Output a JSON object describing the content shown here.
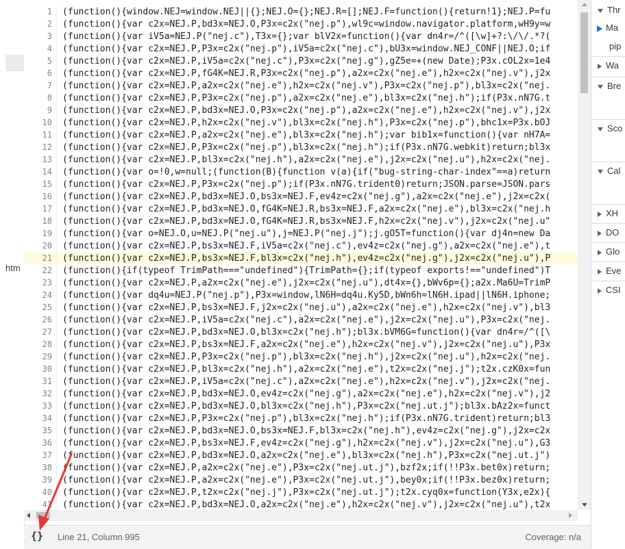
{
  "navigator": {
    "file_label": "htm"
  },
  "editor": {
    "current_line": 21,
    "lines": [
      {
        "n": "1",
        "t": "(function(){window.NEJ=window.NEJ||{};NEJ.O={};NEJ.R=[];NEJ.F=function(){return!1};NEJ.P=fu"
      },
      {
        "n": "2",
        "t": "(function(){var c2x=NEJ.P,bd3x=NEJ.O,P3x=c2x(\"nej.p\"),wl9c=window.navigator.platform,wH9y=w"
      },
      {
        "n": "3",
        "t": "(function(){var iV5a=NEJ.P(\"nej.c\"),T3x={};var blV2x=function(){var dn4r=/^([\\w]+?:\\/\\/.*?("
      },
      {
        "n": "4",
        "t": "(function(){var c2x=NEJ.P,P3x=c2x(\"nej.p\"),iV5a=c2x(\"nej.c\"),bU3x=window.NEJ_CONF||NEJ.O;if"
      },
      {
        "n": "5",
        "t": "(function(){var c2x=NEJ.P,iV5a=c2x(\"nej.c\"),P3x=c2x(\"nej.g\"),gZ5e=+(new Date);P3x.cOL2x=1e4"
      },
      {
        "n": "6",
        "t": "(function(){var c2x=NEJ.P,fG4K=NEJ.R,P3x=c2x(\"nej.p\"),a2x=c2x(\"nej.e\"),h2x=c2x(\"nej.v\"),j2x"
      },
      {
        "n": "7",
        "t": "(function(){var c2x=NEJ.P,a2x=c2x(\"nej.e\"),h2x=c2x(\"nej.v\"),P3x=c2x(\"nej.p\"),bl3x=c2x(\"nej."
      },
      {
        "n": "8",
        "t": "(function(){var c2x=NEJ.P,P3x=c2x(\"nej.p\"),a2x=c2x(\"nej.e\"),bl3x=c2x(\"nej.h\");if(P3x.nN7G.t"
      },
      {
        "n": "9",
        "t": "(function(){var c2x=NEJ.P,bd3x=NEJ.O,P3x=c2x(\"nej.p\"),a2x=c2x(\"nej.e\"),h2x=c2x(\"nej.v\"),j2x"
      },
      {
        "n": "10",
        "t": "(function(){var c2x=NEJ.P,h2x=c2x(\"nej.v\"),bl3x=c2x(\"nej.h\"),P3x=c2x(\"nej.p\"),bhc1x=P3x.bOJ"
      },
      {
        "n": "11",
        "t": "(function(){var c2x=NEJ.P,a2x=c2x(\"nej.e\"),bl3x=c2x(\"nej.h\");var bib1x=function(){var nH7A="
      },
      {
        "n": "12",
        "t": "(function(){var c2x=NEJ.P,P3x=c2x(\"nej.p\"),bl3x=c2x(\"nej.h\");if(P3x.nN7G.webkit)return;bl3x"
      },
      {
        "n": "13",
        "t": "(function(){var c2x=NEJ.P,bl3x=c2x(\"nej.h\"),a2x=c2x(\"nej.e\"),j2x=c2x(\"nej.u\"),h2x=c2x(\"nej."
      },
      {
        "n": "14",
        "t": "(function(){var o=!0,w=null;(function(B){function v(a){if(\"bug-string-char-index\"==a)return"
      },
      {
        "n": "15",
        "t": "(function(){var c2x=NEJ.P,P3x=c2x(\"nej.p\");if(P3x.nN7G.trident0)return;JSON.parse=JSON.pars"
      },
      {
        "n": "16",
        "t": "(function(){var c2x=NEJ.P,bd3x=NEJ.O,bs3x=NEJ.F,ev4z=c2x(\"nej.g\"),a2x=c2x(\"nej.e\"),j2x=c2x("
      },
      {
        "n": "17",
        "t": "(function(){var c2x=NEJ.P,bd3x=NEJ.O,fG4K=NEJ.R,bs3x=NEJ.F,a2x=c2x(\"nej.e\"),bl3x=c2x(\"nej.h"
      },
      {
        "n": "18",
        "t": "(function(){var c2x=NEJ.P,bd3x=NEJ.O,fG4K=NEJ.R,bs3x=NEJ.F,h2x=c2x(\"nej.v\"),j2x=c2x(\"nej.u\""
      },
      {
        "n": "19",
        "t": "(function(){var o=NEJ.O,u=NEJ.P(\"nej.u\"),j=NEJ.P(\"nej.j\");j.gO5T=function(){var dj4n=new Da"
      },
      {
        "n": "20",
        "t": "(function(){var c2x=NEJ.P,bs3x=NEJ.F,iV5a=c2x(\"nej.c\"),ev4z=c2x(\"nej.g\"),a2x=c2x(\"nej.e\"),t"
      },
      {
        "n": "21",
        "t": "(function(){var c2x=NEJ.P,bs3x=NEJ.F,bl3x=c2x(\"nej.h\"),ev4z=c2x(\"nej.g\"),j2x=c2x(\"nej.u\"),P"
      },
      {
        "n": "22",
        "t": "(function(){if(typeof TrimPath===\"undefined\"){TrimPath={};if(typeof exports!==\"undefined\")T"
      },
      {
        "n": "23",
        "t": "(function(){var c2x=NEJ.P,a2x=c2x(\"nej.e\"),j2x=c2x(\"nej.u\"),dt4x={},bWv6p={};a2x.Ma6U=TrimP"
      },
      {
        "n": "24",
        "t": "(function(){var dq4u=NEJ.P(\"nej.p\"),P3x=window,lN6H=dq4u.Ky5D,bWn6h=lN6H.ipad||lN6H.iphone;"
      },
      {
        "n": "25",
        "t": "(function(){var c2x=NEJ.P,bs3x=NEJ.F,j2x=c2x(\"nej.u\"),a2x=c2x(\"nej.e\"),h2x=c2x(\"nej.v\"),bl3"
      },
      {
        "n": "26",
        "t": "(function(){var c2x=NEJ.P,iV5a=c2x(\"nej.c\"),a2x=c2x(\"nej.e\"),j2x=c2x(\"nej.u\"),P3x=c2x(\"nej."
      },
      {
        "n": "27",
        "t": "(function(){var c2x=NEJ.P,bd3x=NEJ.O,bl3x=c2x(\"nej.h\");bl3x.bVM6G=function(){var dn4r=/^([\\"
      },
      {
        "n": "28",
        "t": "(function(){var c2x=NEJ.P,bs3x=NEJ.F,a2x=c2x(\"nej.e\"),h2x=c2x(\"nej.v\"),j2x=c2x(\"nej.u\"),P3x"
      },
      {
        "n": "29",
        "t": "(function(){var c2x=NEJ.P,P3x=c2x(\"nej.p\"),bl3x=c2x(\"nej.h\"),j2x=c2x(\"nej.u\"),h2x=c2x(\"nej."
      },
      {
        "n": "30",
        "t": "(function(){var c2x=NEJ.P,bl3x=c2x(\"nej.h\"),a2x=c2x(\"nej.e\"),t2x=c2x(\"nej.j\");t2x.czK0x=fun"
      },
      {
        "n": "31",
        "t": "(function(){var c2x=NEJ.P,iV5a=c2x(\"nej.c\"),a2x=c2x(\"nej.e\"),h2x=c2x(\"nej.v\"),j2x=c2x(\"nej."
      },
      {
        "n": "32",
        "t": "(function(){var c2x=NEJ.P,bd3x=NEJ.O,ev4z=c2x(\"nej.g\"),a2x=c2x(\"nej.e\"),h2x=c2x(\"nej.v\"),j2"
      },
      {
        "n": "33",
        "t": "(function(){var c2x=NEJ.P,bd3x=NEJ.O,bl3x=c2x(\"nej.h\"),P3x=c2x(\"nej.ut.j\");bl3x.bAz2x=funct"
      },
      {
        "n": "34",
        "t": "(function(){var c2x=NEJ.P,P3x=c2x(\"nej.p\"),bl3x=c2x(\"nej.h\");if(P3x.nN7G.trident)return;bl3"
      },
      {
        "n": "35",
        "t": "(function(){var c2x=NEJ.P,bd3x=NEJ.O,bs3x=NEJ.F,bl3x=c2x(\"nej.h\"),ev4z=c2x(\"nej.g\"),j2x=c2x"
      },
      {
        "n": "36",
        "t": "(function(){var c2x=NEJ.P,bs3x=NEJ.F,ev4z=c2x(\"nej.g\"),h2x=c2x(\"nej.v\"),j2x=c2x(\"nej.u\"),G3"
      },
      {
        "n": "37",
        "t": "(function(){var c2x=NEJ.P,bd3x=NEJ.O,a2x=c2x(\"nej.e\"),bl3x=c2x(\"nej.h\"),P3x=c2x(\"nej.ut.j\")"
      },
      {
        "n": "38",
        "t": "(function(){var c2x=NEJ.P,a2x=c2x(\"nej.e\"),P3x=c2x(\"nej.ut.j\"),bzf2x;if(!!P3x.bet0x)return;"
      },
      {
        "n": "39",
        "t": "(function(){var c2x=NEJ.P,a2x=c2x(\"nej.e\"),P3x=c2x(\"nej.ut.j\"),bey0x;if(!!P3x.bez0x)return;"
      },
      {
        "n": "40",
        "t": "(function(){var c2x=NEJ.P,t2x=c2x(\"nej.j\"),P3x=c2x(\"nej.ut.j\");t2x.cyq0x=function(Y3x,e2x){"
      },
      {
        "n": "41",
        "t": "(function(){var c2x=NEJ.P,bd3x=NEJ.O,a2x=c2x(\"nej.e\"),h2x=c2x(\"nej.v\"),j2x=c2x(\"nej.u\"),t2x"
      }
    ]
  },
  "status": {
    "pretty_print": "{}",
    "position": "Line 21, Column 995",
    "coverage": "Coverage: n/a"
  },
  "right_panel": {
    "sections": [
      {
        "label": "Thr",
        "open": true
      },
      {
        "label": "Wa",
        "open": false
      },
      {
        "label": "Bre",
        "open": true
      },
      {
        "label": "Sco",
        "open": true
      },
      {
        "label": "Cal",
        "open": true
      },
      {
        "label": "XH",
        "open": false
      },
      {
        "label": "DO",
        "open": false
      },
      {
        "label": "Glo",
        "open": false
      },
      {
        "label": "Eve",
        "open": false
      },
      {
        "label": "CSI",
        "open": false
      }
    ],
    "threads": [
      {
        "label": "Ma",
        "pointer": true
      },
      {
        "label": "pip",
        "pointer": false
      }
    ]
  },
  "colors": {
    "accent": "#1a73e8",
    "current_line": "#fffbdd",
    "annotation": "#e53935"
  }
}
